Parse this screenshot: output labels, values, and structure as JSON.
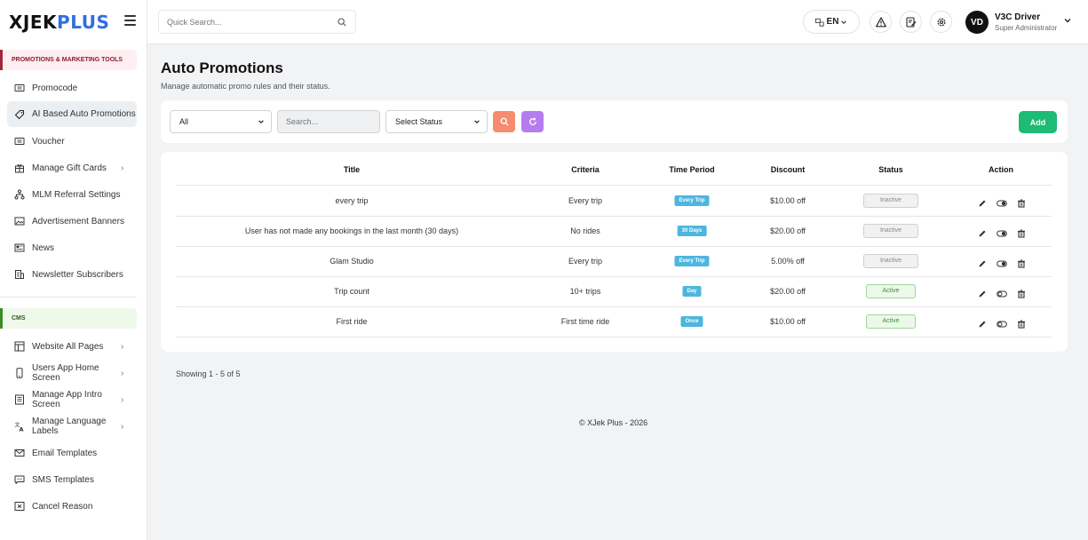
{
  "brand": {
    "part1": "XJEK",
    "part2": "PLUS"
  },
  "sidebar": {
    "promo_section": "PROMOTIONS & MARKETING TOOLS",
    "promo_items": [
      {
        "label": "Promocode",
        "icon": "ticket-icon",
        "has_arrow": false
      },
      {
        "label": "AI Based Auto Promotions",
        "icon": "tag-icon",
        "has_arrow": false,
        "active": true
      },
      {
        "label": "Voucher",
        "icon": "ticket-icon",
        "has_arrow": false
      },
      {
        "label": "Manage Gift Cards",
        "icon": "gift-icon",
        "has_arrow": true
      },
      {
        "label": "MLM Referral Settings",
        "icon": "network-icon",
        "has_arrow": false
      },
      {
        "label": "Advertisement Banners",
        "icon": "image-icon",
        "has_arrow": false
      },
      {
        "label": "News",
        "icon": "newspaper-icon",
        "has_arrow": false
      },
      {
        "label": "Newsletter Subscribers",
        "icon": "building-icon",
        "has_arrow": false
      }
    ],
    "cms_section": "CMS",
    "cms_items": [
      {
        "label": "Website All Pages",
        "icon": "layout-icon",
        "has_arrow": true
      },
      {
        "label": "Users App Home Screen",
        "icon": "phone-icon",
        "has_arrow": true
      },
      {
        "label": "Manage App Intro Screen",
        "icon": "document-icon",
        "has_arrow": true
      },
      {
        "label": "Manage Language Labels",
        "icon": "translate-icon",
        "has_arrow": true
      },
      {
        "label": "Email Templates",
        "icon": "mail-icon",
        "has_arrow": false
      },
      {
        "label": "SMS Templates",
        "icon": "chat-icon",
        "has_arrow": false
      },
      {
        "label": "Cancel Reason",
        "icon": "cancel-box-icon",
        "has_arrow": false
      }
    ]
  },
  "header": {
    "search_placeholder": "Quick Search...",
    "lang": "EN",
    "user_initials": "VD",
    "user_name": "V3C Driver",
    "user_role": "Super Administrator"
  },
  "page": {
    "title": "Auto Promotions",
    "subtitle": "Manage automatic promo rules and their status."
  },
  "filters": {
    "type_value": "All",
    "search_placeholder": "Search...",
    "status_value": "Select Status",
    "add_label": "Add"
  },
  "table": {
    "columns": [
      "Title",
      "Criteria",
      "Time Period",
      "Discount",
      "Status",
      "Action"
    ],
    "rows": [
      {
        "title": "every trip",
        "criteria": "Every trip",
        "period": "Every Trip",
        "discount": "$10.00 off",
        "status": "Inactive"
      },
      {
        "title": "User has not made any bookings in the last month (30 days)",
        "criteria": "No rides",
        "period": "30 Days",
        "discount": "$20.00 off",
        "status": "Inactive"
      },
      {
        "title": "Glam Studio",
        "criteria": "Every trip",
        "period": "Every Trip",
        "discount": "5.00% off",
        "status": "Inactive"
      },
      {
        "title": "Trip count",
        "criteria": "10+ trips",
        "period": "Day",
        "discount": "$20.00 off",
        "status": "Active"
      },
      {
        "title": "First ride",
        "criteria": "First time ride",
        "period": "Once",
        "discount": "$10.00 off",
        "status": "Active"
      }
    ]
  },
  "pagination": {
    "showing": "Showing 1 - 5 of 5"
  },
  "footer": {
    "text": "© XJek Plus - 2026"
  },
  "colors": {
    "brand_blue": "#2f6fe0",
    "add_green": "#1dbb73",
    "search_orange": "#f58c6e",
    "reset_purple": "#b57cf0",
    "tag_blue": "#4db6de",
    "promo_section": "#a1263c",
    "cms_section": "#3d8a27"
  }
}
